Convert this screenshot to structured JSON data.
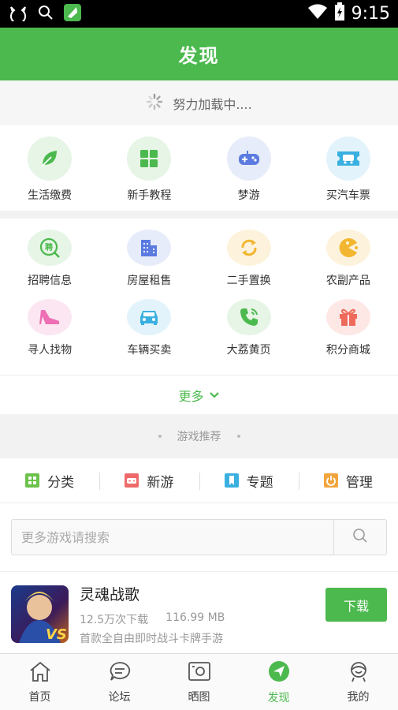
{
  "status_bar": {
    "time": "9:15"
  },
  "header": {
    "title": "发现"
  },
  "loading": {
    "text": "努力加载中...."
  },
  "grid_primary": [
    {
      "label": "生活缴费",
      "icon": "leaf-icon",
      "bg": "#e6f5e6",
      "color": "#4cb94e"
    },
    {
      "label": "新手教程",
      "icon": "grid-icon",
      "bg": "#e6f5e6",
      "color": "#4cb94e"
    },
    {
      "label": "梦游",
      "icon": "gamepad-icon",
      "bg": "#e6ecfa",
      "color": "#5b7be0"
    },
    {
      "label": "买汽车票",
      "icon": "bus-ticket-icon",
      "bg": "#e3f3fb",
      "color": "#3ab0e0"
    }
  ],
  "grid_secondary": [
    {
      "label": "招聘信息",
      "icon": "recruit-icon",
      "bg": "#e6f5e6",
      "color": "#4cb94e"
    },
    {
      "label": "房屋租售",
      "icon": "building-icon",
      "bg": "#e6ecfa",
      "color": "#5b7be0"
    },
    {
      "label": "二手置换",
      "icon": "exchange-icon",
      "bg": "#fdf3dc",
      "color": "#f2b630"
    },
    {
      "label": "农副产品",
      "icon": "pacman-icon",
      "bg": "#fdf3dc",
      "color": "#f2b630"
    },
    {
      "label": "寻人找物",
      "icon": "shoe-icon",
      "bg": "#fce6f2",
      "color": "#ee6fb4"
    },
    {
      "label": "车辆买卖",
      "icon": "car-icon",
      "bg": "#e3f3fb",
      "color": "#3ab0e0"
    },
    {
      "label": "大荔黄页",
      "icon": "phone-icon",
      "bg": "#e6f5e6",
      "color": "#4cb94e"
    },
    {
      "label": "积分商城",
      "icon": "gift-icon",
      "bg": "#fde8e6",
      "color": "#ee6a5a"
    }
  ],
  "more": {
    "label": "更多"
  },
  "section": {
    "title": "游戏推荐"
  },
  "tabs": [
    {
      "label": "分类",
      "icon": "category-icon",
      "color": "#6cc24a"
    },
    {
      "label": "新游",
      "icon": "new-game-icon",
      "color": "#ee6a6a"
    },
    {
      "label": "专题",
      "icon": "bookmark-icon",
      "color": "#3ab0e0"
    },
    {
      "label": "管理",
      "icon": "manage-icon",
      "color": "#f2a53c"
    }
  ],
  "search": {
    "placeholder": "更多游戏请搜索"
  },
  "game": {
    "name": "灵魂战歌",
    "downloads": "12.5万次下载",
    "size": "116.99 MB",
    "description": "首款全自由即时战斗卡牌手游",
    "download_label": "下载"
  },
  "bottom_nav": [
    {
      "label": "首页",
      "icon": "home-icon"
    },
    {
      "label": "论坛",
      "icon": "forum-icon"
    },
    {
      "label": "晒图",
      "icon": "photo-icon"
    },
    {
      "label": "发现",
      "icon": "discover-icon",
      "active": true
    },
    {
      "label": "我的",
      "icon": "profile-icon"
    }
  ]
}
